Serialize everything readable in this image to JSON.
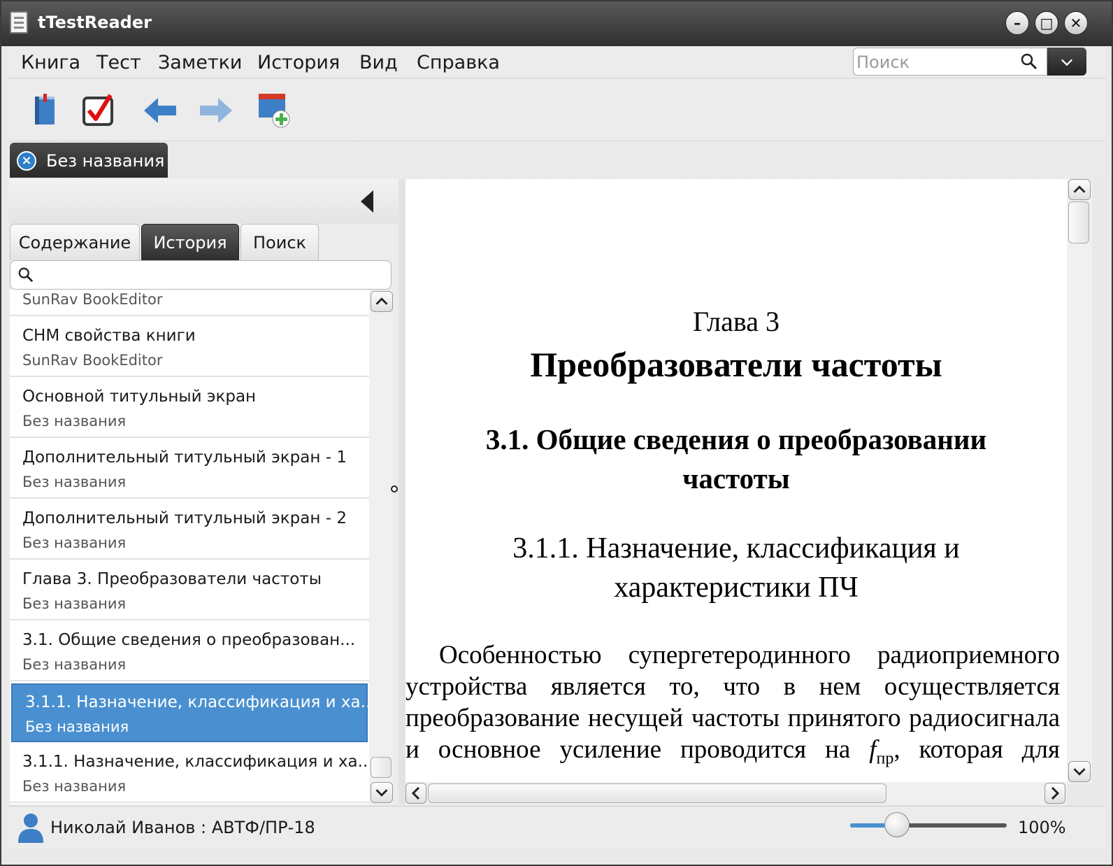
{
  "window": {
    "title": "tTestReader"
  },
  "menu": [
    "Книга",
    "Тест",
    "Заметки",
    "История",
    "Вид",
    "Справка"
  ],
  "search": {
    "placeholder": "Поиск"
  },
  "toolbar": {
    "icons": [
      "book-icon",
      "test-checklist-icon",
      "back-arrow-icon",
      "forward-arrow-icon",
      "add-note-icon"
    ]
  },
  "doc_tab": {
    "label": "Без названия"
  },
  "left_panel": {
    "tabs": [
      "Содержание",
      "История",
      "Поиск"
    ],
    "active_tab": "История",
    "history": [
      {
        "title": "",
        "sub": "SunRav BookEditor"
      },
      {
        "title": "CHM свойства книги",
        "sub": "SunRav BookEditor"
      },
      {
        "title": "Основной титульный экран",
        "sub": "Без названия"
      },
      {
        "title": "Дополнительный титульный экран - 1",
        "sub": "Без названия"
      },
      {
        "title": "Дополнительный титульный экран - 2",
        "sub": "Без названия"
      },
      {
        "title": "Глава 3. Преобразователи частоты",
        "sub": "Без названия"
      },
      {
        "title": "3.1. Общие сведения о преобразован...",
        "sub": "Без названия"
      },
      {
        "title": "3.1.1. Назначение, классификация и ха...",
        "sub": "Без названия",
        "selected": true
      },
      {
        "title": "3.1.1. Назначение, классификация и ха...",
        "sub": "Без названия"
      }
    ]
  },
  "document": {
    "chapter": "Глава 3",
    "chapter_title": "Преобразователи частоты",
    "section_title": "3.1. Общие сведения о преобразовании частоты",
    "subsection_title": "3.1.1. Назначение, классификация и характеристики ПЧ",
    "paragraph_lead": "Особенностью супергетеродинного радиоприемного устройства является то, что в нем осуществляется преобразование несущей частоты принятого радиосигнала и основное усиление проводится на ",
    "paragraph_symbol": "f",
    "paragraph_subscript": "пр",
    "paragraph_tail": ", которая для приемника постоянна и значительно ниже"
  },
  "status": {
    "user": "Николай Иванов : АВТФ/ПР-18",
    "zoom_label": "100%",
    "zoom_fraction": 0.3,
    "accent": "#4a90d0"
  }
}
